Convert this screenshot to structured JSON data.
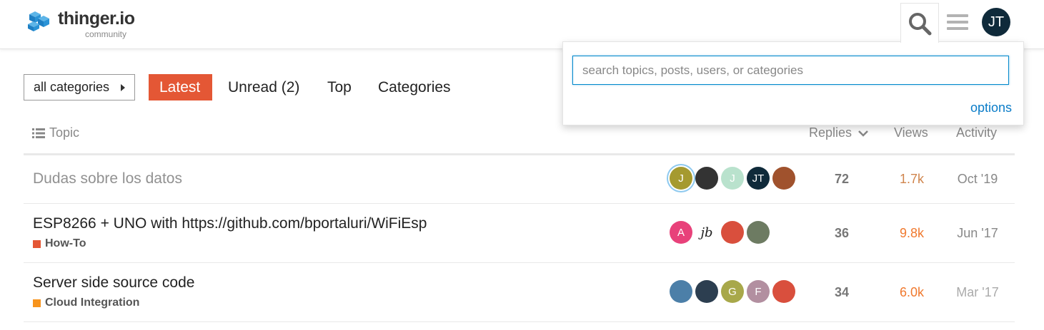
{
  "header": {
    "logo_text": "thinger.io",
    "logo_subtext": "community",
    "user_initials": "JT",
    "brand_color": "#1e7fc4"
  },
  "search": {
    "placeholder": "search topics, posts, users, or categories",
    "value": "",
    "options_label": "options"
  },
  "nav": {
    "category_dropdown": "all categories",
    "tabs": [
      {
        "label": "Latest",
        "active": true
      },
      {
        "label": "Unread (2)",
        "active": false
      },
      {
        "label": "Top",
        "active": false
      },
      {
        "label": "Categories",
        "active": false
      }
    ]
  },
  "table": {
    "headers": {
      "topic": "Topic",
      "replies": "Replies",
      "views": "Views",
      "activity": "Activity"
    },
    "rows": [
      {
        "title": "Dudas sobre los datos",
        "category": "",
        "category_color": "",
        "posters": [
          {
            "initial": "J",
            "color": "#a59a2f",
            "highlight": true
          },
          {
            "initial": "",
            "color": "#333333"
          },
          {
            "initial": "J",
            "color": "#b9e2cd"
          },
          {
            "initial": "JT",
            "color": "#0f2a3a"
          },
          {
            "initial": "",
            "color": "#a0522d"
          }
        ],
        "replies": "72",
        "views": "1.7k",
        "views_color": "#d0854d",
        "activity": "Oct '19",
        "read": true
      },
      {
        "title": "ESP8266 + UNO with https://github.com/bportaluri/WiFiEsp",
        "category": "How-To",
        "category_color": "#e45735",
        "posters": [
          {
            "initial": "A",
            "color": "#e8417a"
          },
          {
            "initial": "jb",
            "color": "#ffffff"
          },
          {
            "initial": "",
            "color": "#d94f3d"
          },
          {
            "initial": "",
            "color": "#6d7b62"
          }
        ],
        "replies": "36",
        "views": "9.8k",
        "views_color": "#f0792e",
        "activity": "Jun '17",
        "read": false
      },
      {
        "title": "Server side source code",
        "category": "Cloud Integration",
        "category_color": "#f7941d",
        "posters": [
          {
            "initial": "",
            "color": "#4c7fa8"
          },
          {
            "initial": "",
            "color": "#2c3e50"
          },
          {
            "initial": "G",
            "color": "#a8a84a"
          },
          {
            "initial": "F",
            "color": "#b28fa0"
          },
          {
            "initial": "",
            "color": "#d94f3d"
          }
        ],
        "replies": "34",
        "views": "6.0k",
        "views_color": "#f0792e",
        "activity": "Mar '17",
        "read": false
      }
    ]
  }
}
